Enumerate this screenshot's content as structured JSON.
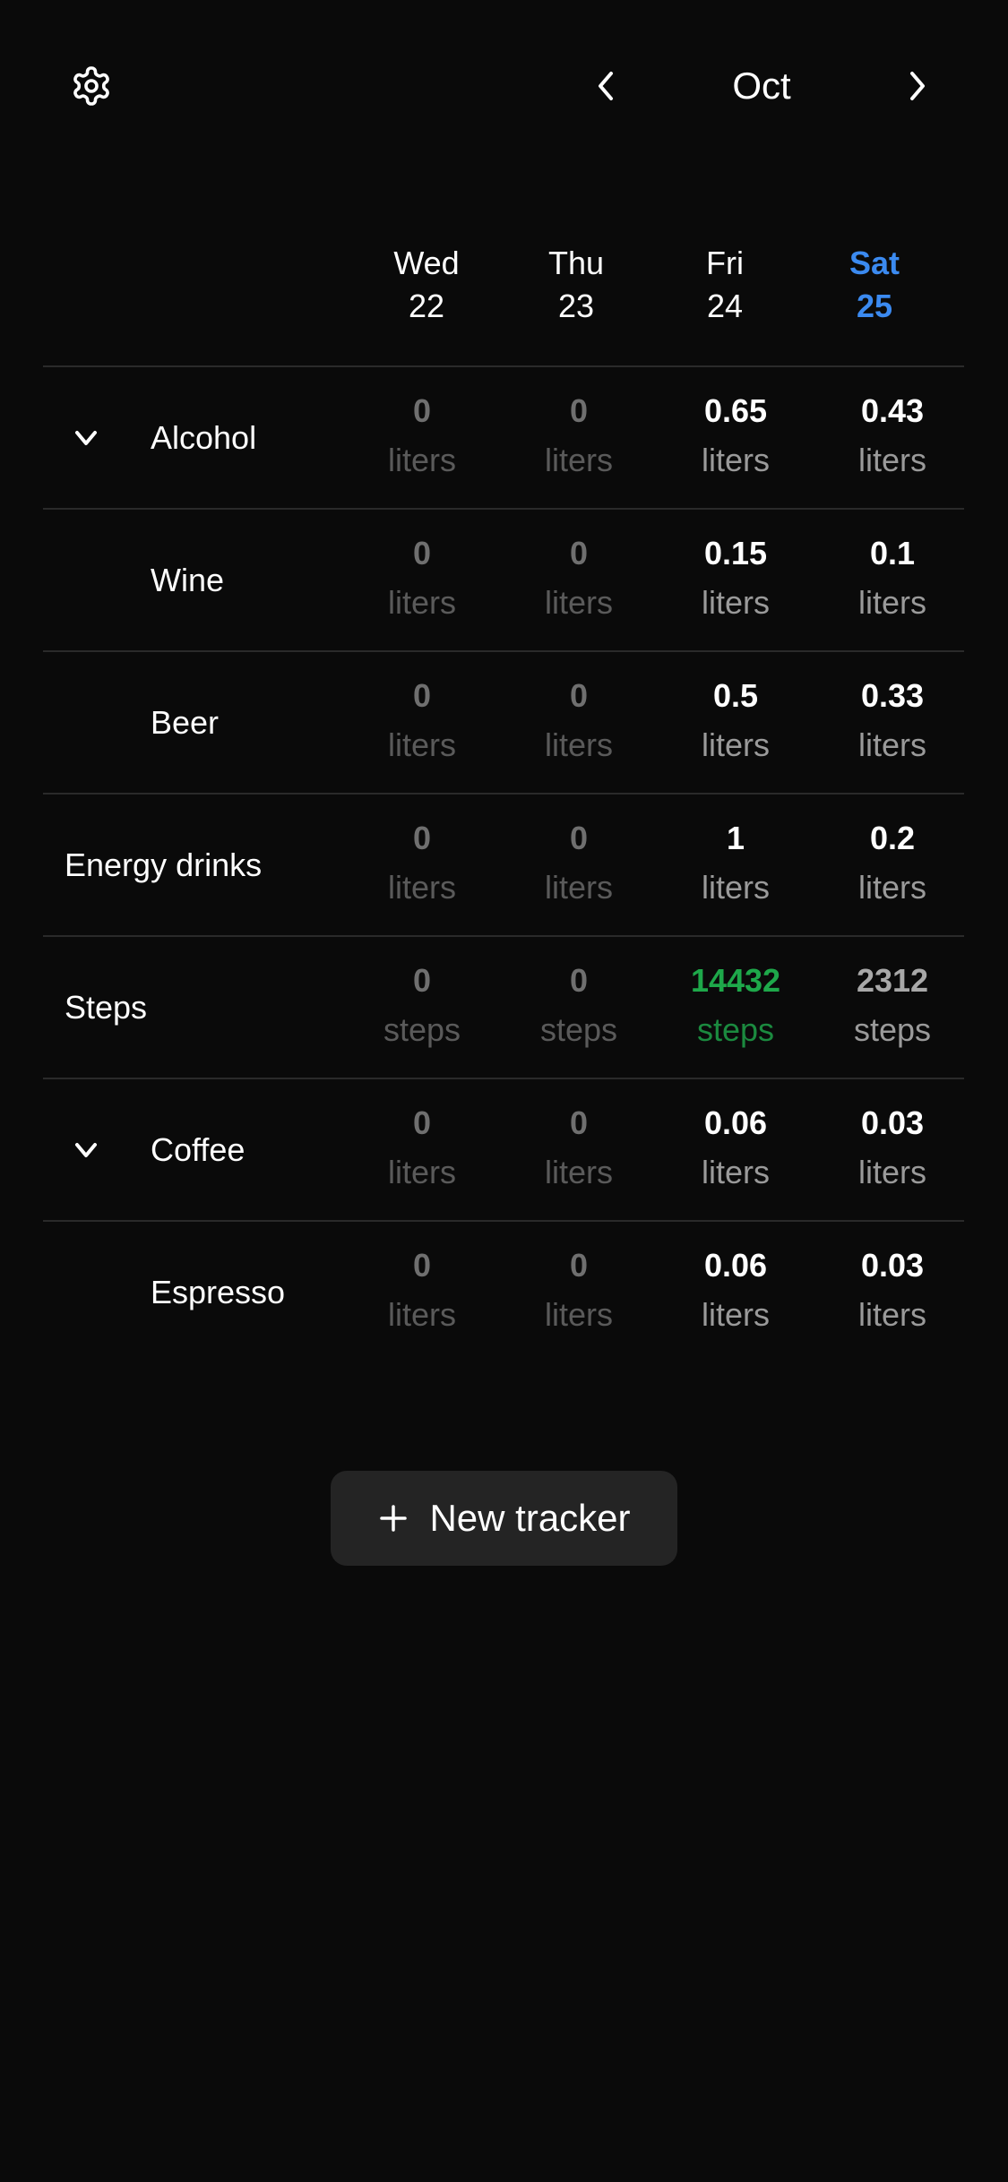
{
  "header": {
    "month": "Oct",
    "settings_icon": "gear-icon",
    "prev_icon": "chevron-left-icon",
    "next_icon": "chevron-right-icon"
  },
  "days": [
    {
      "weekday": "Wed",
      "date": "22",
      "today": false
    },
    {
      "weekday": "Thu",
      "date": "23",
      "today": false
    },
    {
      "weekday": "Fri",
      "date": "24",
      "today": false
    },
    {
      "weekday": "Sat",
      "date": "25",
      "today": true
    }
  ],
  "trackers": [
    {
      "label": "Alcohol",
      "expandable": true,
      "values": [
        {
          "v": "0",
          "u": "liters"
        },
        {
          "v": "0",
          "u": "liters"
        },
        {
          "v": "0.65",
          "u": "liters"
        },
        {
          "v": "0.43",
          "u": "liters"
        }
      ]
    },
    {
      "label": "Wine",
      "child": true,
      "values": [
        {
          "v": "0",
          "u": "liters"
        },
        {
          "v": "0",
          "u": "liters"
        },
        {
          "v": "0.15",
          "u": "liters"
        },
        {
          "v": "0.1",
          "u": "liters"
        }
      ]
    },
    {
      "label": "Beer",
      "child": true,
      "values": [
        {
          "v": "0",
          "u": "liters"
        },
        {
          "v": "0",
          "u": "liters"
        },
        {
          "v": "0.5",
          "u": "liters"
        },
        {
          "v": "0.33",
          "u": "liters"
        }
      ]
    },
    {
      "label": "Energy drinks",
      "values": [
        {
          "v": "0",
          "u": "liters"
        },
        {
          "v": "0",
          "u": "liters"
        },
        {
          "v": "1",
          "u": "liters"
        },
        {
          "v": "0.2",
          "u": "liters"
        }
      ]
    },
    {
      "label": "Steps",
      "values": [
        {
          "v": "0",
          "u": "steps"
        },
        {
          "v": "0",
          "u": "steps"
        },
        {
          "v": "14432",
          "u": "steps",
          "goal_met": true
        },
        {
          "v": "2312",
          "u": "steps"
        }
      ]
    },
    {
      "label": "Coffee",
      "expandable": true,
      "values": [
        {
          "v": "0",
          "u": "liters"
        },
        {
          "v": "0",
          "u": "liters"
        },
        {
          "v": "0.06",
          "u": "liters"
        },
        {
          "v": "0.03",
          "u": "liters"
        }
      ]
    },
    {
      "label": "Espresso",
      "child": true,
      "values": [
        {
          "v": "0",
          "u": "liters"
        },
        {
          "v": "0",
          "u": "liters"
        },
        {
          "v": "0.06",
          "u": "liters"
        },
        {
          "v": "0.03",
          "u": "liters"
        }
      ]
    }
  ],
  "actions": {
    "new_tracker_label": "New tracker",
    "new_tracker_icon": "plus-icon"
  },
  "colors": {
    "background": "#0a0a0a",
    "today_accent": "#3b8af0",
    "goal_green": "#1ea84a",
    "button_bg": "#242424"
  }
}
